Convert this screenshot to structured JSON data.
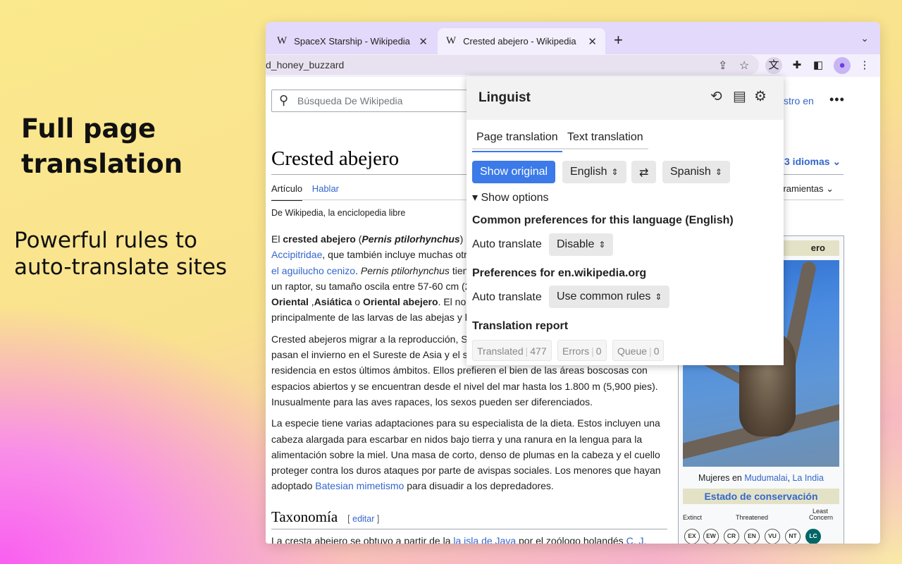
{
  "hero": {
    "title": "Full page translation",
    "subtitle": "Powerful rules to auto-translate sites"
  },
  "browser": {
    "tabs": [
      {
        "title": "SpaceX Starship - Wikipedia",
        "favicon": "W"
      },
      {
        "title": "Crested abejero - Wikipedia",
        "favicon": "W"
      }
    ],
    "new_tab": "+",
    "url": "d_honey_buzzard",
    "accent": "#e3d9fb"
  },
  "wiki": {
    "search_placeholder": "Búsqueda De Wikipedia",
    "login": "stro en",
    "more": "•••",
    "title": "Crested abejero",
    "languages": "3 idiomas ⌄",
    "tab_article": "Artículo",
    "tab_talk": "Hablar",
    "tools": "lerramientas ⌄",
    "from": "De Wikipedia, la enciclopedia libre",
    "p1_l1a": "El ",
    "p1_l1b": "crested abejero",
    "p1_l1c": " (",
    "p1_l1d": "Pernis ptilorhynchus",
    "p1_l1e": ")",
    "p1_l2a": "Accipitridae",
    "p1_l2b": ", que también incluye muchas otr",
    "p1_l3a": "el aguilucho cenizo",
    "p1_l3b": ". ",
    "p1_l3c": "Pernis ptilorhynchus",
    "p1_l3d": " tien",
    "p1_l4": "un raptor, su tamaño oscila entre 57-60 cm (2",
    "p1_l5a": "Oriental",
    "p1_l5b": " ,",
    "p1_l5c": "Asiática",
    "p1_l5d": " o ",
    "p1_l5e": "Oriental abejero",
    "p1_l5f": ". El no",
    "p1_l6": "principalmente de las larvas de las abejas y l",
    "p2_l1": "Crested abejeros migrar a la reproducción, S",
    "p2_l2": "pasan el invierno en el Sureste de Asia y el s",
    "p2_l3": "residencia en estos últimos ámbitos. Ellos prefieren el bien de las áreas boscosas con",
    "p2_l4": "espacios abiertos y se encuentran desde el nivel del mar hasta los 1.800 m (5,900 pies).",
    "p2_l5": "Inusualmente para las aves rapaces, los sexos pueden ser diferenciados.",
    "p3_l1": "La especie tiene varias adaptaciones para su especialista de la dieta. Estos incluyen una",
    "p3_l2": "cabeza alargada para escarbar en nidos bajo tierra y una ranura en la lengua para la",
    "p3_l3": "alimentación sobre la miel. Una masa de corto, denso de plumas en la cabeza y el cuello",
    "p3_l4": "proteger contra los duros ataques por parte de avispas sociales. Los menores que hayan",
    "p3_l5a": "adoptado ",
    "p3_l5b": "Batesian mimetismo",
    "p3_l5c": " para disuadir a los depredadores.",
    "infobox_head": "ero",
    "caption_a": "Mujeres en ",
    "caption_b": "Mudumalai",
    "caption_c": ", ",
    "caption_d": "La India",
    "conservation": "Estado de conservación",
    "scale_extinct": "Extinct",
    "scale_threatened": "Threatened",
    "scale_least": "Least",
    "scale_concern": "Concern",
    "status_codes": [
      "EX",
      "EW",
      "CR",
      "EN",
      "VU",
      "NT",
      "LC"
    ],
    "section": "Taxonomía",
    "edit_open": "[ ",
    "edit": "editar",
    "edit_close": " ]",
    "tax_a": "La cresta abejero se obtuvo a partir de la ",
    "tax_b": "la isla de Java",
    "tax_c": " por el zoólogo holandés ",
    "tax_d": "C. J."
  },
  "popup": {
    "title": "Linguist",
    "tab_page": "Page translation",
    "tab_text": "Text translation",
    "show_original": "Show original",
    "from_lang": "English",
    "swap": "⇄",
    "to_lang": "Spanish",
    "show_options": "▾ Show options",
    "common_heading": "Common preferences for this language (English)",
    "auto_translate": "Auto translate",
    "common_value": "Disable",
    "site_heading": "Preferences for en.wikipedia.org",
    "site_value": "Use common rules",
    "report_heading": "Translation report",
    "report": [
      {
        "label": "Translated",
        "value": "477"
      },
      {
        "label": "Errors",
        "value": "0"
      },
      {
        "label": "Queue",
        "value": "0"
      }
    ],
    "accent": "#3b7ae8"
  }
}
